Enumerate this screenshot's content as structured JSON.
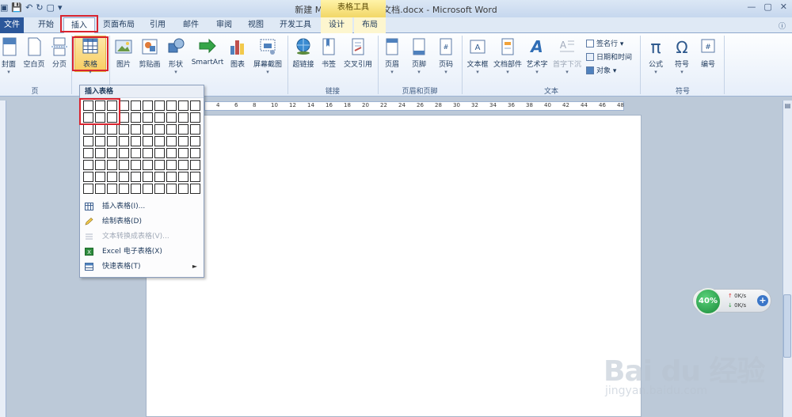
{
  "title_bar": {
    "title": "新建 Microsoft Word 文档.docx - Microsoft Word",
    "context_header": "表格工具"
  },
  "tabs": [
    {
      "label": "文件",
      "id": "file"
    },
    {
      "label": "开始",
      "id": "home"
    },
    {
      "label": "插入",
      "id": "insert",
      "active": true
    },
    {
      "label": "页面布局",
      "id": "page-layout"
    },
    {
      "label": "引用",
      "id": "references"
    },
    {
      "label": "邮件",
      "id": "mailings"
    },
    {
      "label": "审阅",
      "id": "review"
    },
    {
      "label": "视图",
      "id": "view"
    },
    {
      "label": "开发工具",
      "id": "developer"
    },
    {
      "label": "设计",
      "id": "design"
    },
    {
      "label": "布局",
      "id": "layout"
    }
  ],
  "ribbon": {
    "cover": "封面",
    "blank_page": "空白页",
    "page_break": "分页",
    "table": "表格",
    "picture": "图片",
    "clipart": "剪贴画",
    "shapes": "形状",
    "smartart": "SmartArt",
    "chart": "图表",
    "screenshot": "屏幕截图",
    "hyperlink": "超链接",
    "bookmark": "书签",
    "cross_ref": "交叉引用",
    "header": "页眉",
    "footer": "页脚",
    "page_number": "页码",
    "textbox": "文本框",
    "quickparts": "文档部件",
    "wordart": "艺术字",
    "dropcap": "首字下沉",
    "signature": "签名行",
    "datetime": "日期和时间",
    "object": "对象",
    "equation": "公式",
    "symbol": "符号",
    "number": "编号",
    "groups": {
      "pages": "页",
      "links": "链接",
      "header_footer": "页眉和页脚",
      "text": "文本",
      "symbols": "符号"
    },
    "colors": {
      "highlight": "#d9232e",
      "accent": "#2b579a"
    }
  },
  "ruler_ticks": [
    "4",
    "6",
    "8",
    "10",
    "12",
    "14",
    "16",
    "18",
    "20",
    "22",
    "24",
    "26",
    "28",
    "30",
    "32",
    "34",
    "36",
    "38",
    "40",
    "42",
    "44",
    "46",
    "48"
  ],
  "table_menu": {
    "header": "插入表格",
    "grid_cols": 10,
    "grid_rows": 8,
    "items": [
      {
        "label": "插入表格(I)...",
        "disabled": false
      },
      {
        "label": "绘制表格(D)",
        "disabled": false
      },
      {
        "label": "文本转换成表格(V)...",
        "disabled": true
      },
      {
        "label": "Excel 电子表格(X)",
        "disabled": false
      },
      {
        "label": "快速表格(T)",
        "disabled": false,
        "submenu_arrow": "►"
      }
    ]
  },
  "net_widget": {
    "percent": "40%",
    "up": "0K/s",
    "down": "0K/s",
    "plus": "+"
  },
  "watermark": {
    "brand": "Bai du 经验",
    "url": "jingyan.baidu.com"
  }
}
